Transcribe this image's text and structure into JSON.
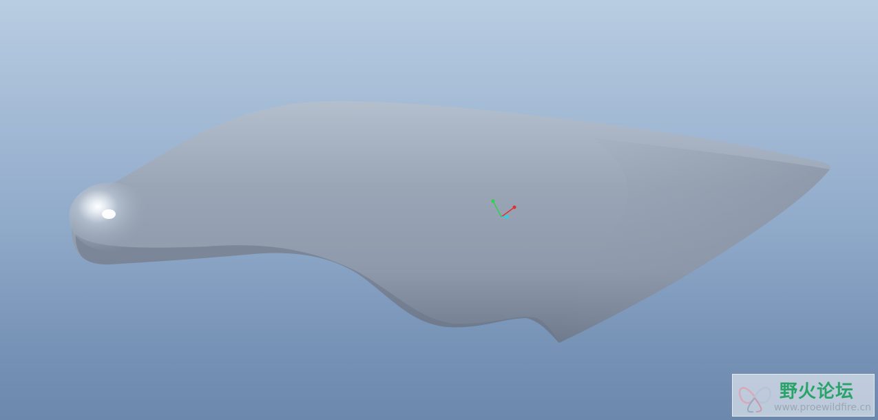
{
  "viewport": {
    "background_top": "#b9cde2",
    "background_bottom": "#6c88ad",
    "model_color": "#9aa7b6"
  },
  "csys": {
    "x_axis_color": "#e03030",
    "y_axis_color": "#30d050",
    "z_axis_color": "#30d0e0"
  },
  "watermark": {
    "title": "野火论坛",
    "url": "www.proewildfire.cn",
    "title_color": "#2aa36a"
  }
}
